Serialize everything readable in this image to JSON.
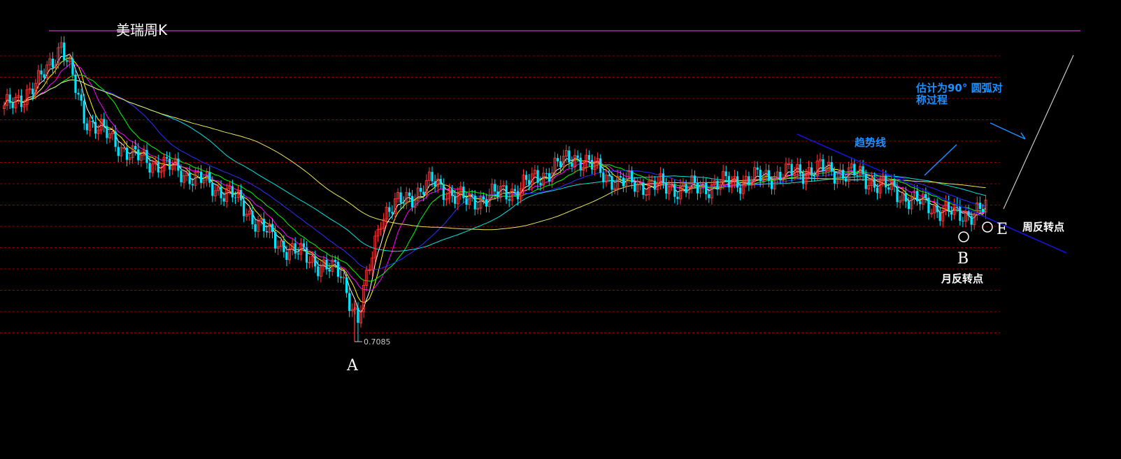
{
  "title": "美瑞周K",
  "colors": {
    "background": "#000000",
    "up_candle": "#ff3b3b",
    "down_candle": "#00e5ff",
    "grid": "#8b0000",
    "top_line": "#a0309a",
    "trendline": "#1515d8",
    "annotation_blue": "#1e90ff"
  },
  "annotations": {
    "low_value": "0.7085",
    "point_a": "A",
    "point_b": "B",
    "point_e": "E",
    "month_reversal": "月反转点",
    "week_reversal": "周反转点",
    "trendline_label": "趋势线",
    "arc_note_line1": "估计为90° 圆弧对",
    "arc_note_line2": "称过程"
  },
  "chart_data": {
    "type": "candlestick",
    "title": "美瑞周K",
    "grid": "horizontal dashed",
    "low": 0.7085,
    "ylim": [
      0.68,
      1.18
    ],
    "close_path_approx": [
      {
        "bar": 0,
        "close": 1.06
      },
      {
        "bar": 12,
        "close": 1.1
      },
      {
        "bar": 20,
        "close": 1.16
      },
      {
        "bar": 28,
        "close": 1.05
      },
      {
        "bar": 45,
        "close": 0.99
      },
      {
        "bar": 60,
        "close": 0.97
      },
      {
        "bar": 80,
        "close": 0.93
      },
      {
        "bar": 95,
        "close": 0.86
      },
      {
        "bar": 118,
        "close": 0.81
      },
      {
        "bar": 124,
        "close": 0.74
      },
      {
        "bar": 132,
        "close": 0.9
      },
      {
        "bar": 150,
        "close": 0.95
      },
      {
        "bar": 162,
        "close": 0.92
      },
      {
        "bar": 180,
        "close": 0.94
      },
      {
        "bar": 200,
        "close": 0.99
      },
      {
        "bar": 215,
        "close": 0.95
      },
      {
        "bar": 240,
        "close": 0.94
      },
      {
        "bar": 270,
        "close": 0.96
      },
      {
        "bar": 285,
        "close": 0.97
      },
      {
        "bar": 300,
        "close": 0.96
      },
      {
        "bar": 320,
        "close": 0.92
      },
      {
        "bar": 335,
        "close": 0.9
      },
      {
        "bar": 344,
        "close": 0.91
      }
    ],
    "moving_average_colors": [
      "#ffffff",
      "#ffff00",
      "#ff00ff",
      "#00ff00",
      "#3030ff",
      "#00e5e5",
      "#e8e85a"
    ]
  }
}
